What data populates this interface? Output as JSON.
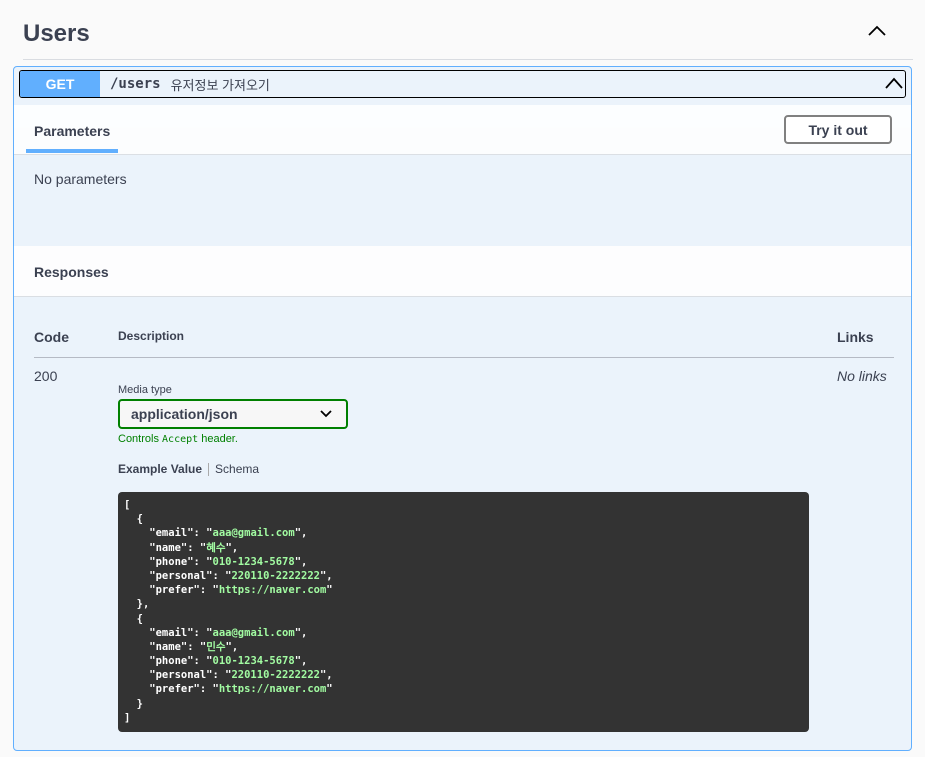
{
  "section": {
    "title": "Users"
  },
  "operation": {
    "method": "GET",
    "path": "/users",
    "description": "유저정보 가져오기"
  },
  "parameters": {
    "tab_label": "Parameters",
    "try_button": "Try it out",
    "empty_text": "No parameters"
  },
  "responses": {
    "title": "Responses",
    "columns": {
      "code": "Code",
      "description": "Description",
      "links": "Links"
    },
    "row": {
      "code": "200",
      "links_text": "No links",
      "media_type_label": "Media type",
      "media_type_value": "application/json",
      "controls_prefix": "Controls",
      "controls_mono": "Accept",
      "controls_suffix": "header.",
      "example_tab": "Example Value",
      "schema_tab": "Schema"
    },
    "example": [
      {
        "email": "aaa@gmail.com",
        "name": "혜수",
        "phone": "010-1234-5678",
        "personal": "220110-2222222",
        "prefer": "https://naver.com"
      },
      {
        "email": "aaa@gmail.com",
        "name": "민수",
        "phone": "010-1234-5678",
        "personal": "220110-2222222",
        "prefer": "https://naver.com"
      }
    ]
  },
  "colors": {
    "get_accent": "#61affe",
    "select_border": "#008000",
    "code_bg": "#333333",
    "code_string": "#a2fca2"
  }
}
